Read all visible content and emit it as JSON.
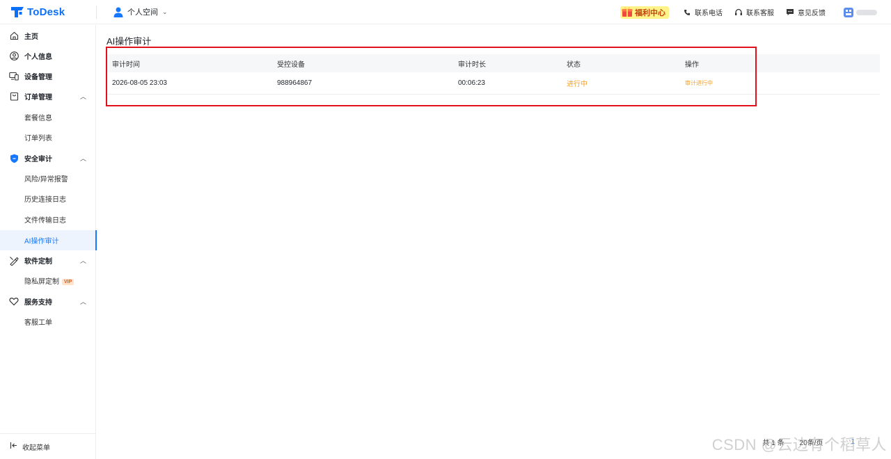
{
  "app": {
    "logo_text": "ToDesk",
    "workspace_label": "个人空间"
  },
  "topbar": {
    "benefit_label": "福利中心",
    "phone_label": "联系电话",
    "service_label": "联系客服",
    "feedback_label": "意见反馈"
  },
  "sidebar": {
    "home": "主页",
    "profile": "个人信息",
    "devices": "设备管理",
    "orders": "订单管理",
    "orders_sub": [
      "套餐信息",
      "订单列表"
    ],
    "security": "安全审计",
    "security_sub": [
      "风险/异常报警",
      "历史连接日志",
      "文件传输日志",
      "AI操作审计"
    ],
    "custom": "软件定制",
    "custom_sub_label": "隐私屏定制",
    "custom_sub_badge": "VIP",
    "support": "服务支持",
    "support_sub": [
      "客服工单"
    ],
    "collapse": "收起菜单"
  },
  "main": {
    "title": "AI操作审计",
    "columns": [
      "审计时间",
      "受控设备",
      "审计时长",
      "状态",
      "操作"
    ],
    "rows": [
      {
        "time": "2026-08-05 23:03",
        "device": "988964867",
        "duration": "00:06:23",
        "status": "进行中",
        "action": "审计进行中"
      }
    ]
  },
  "pagination": {
    "total": "共 1 条",
    "page_size": "20条/页",
    "current": "1"
  },
  "watermark": "CSDN @云边有个稻草人",
  "colors": {
    "accent": "#1677ff",
    "status": "#f5a028",
    "highlight": "#e0101c"
  }
}
